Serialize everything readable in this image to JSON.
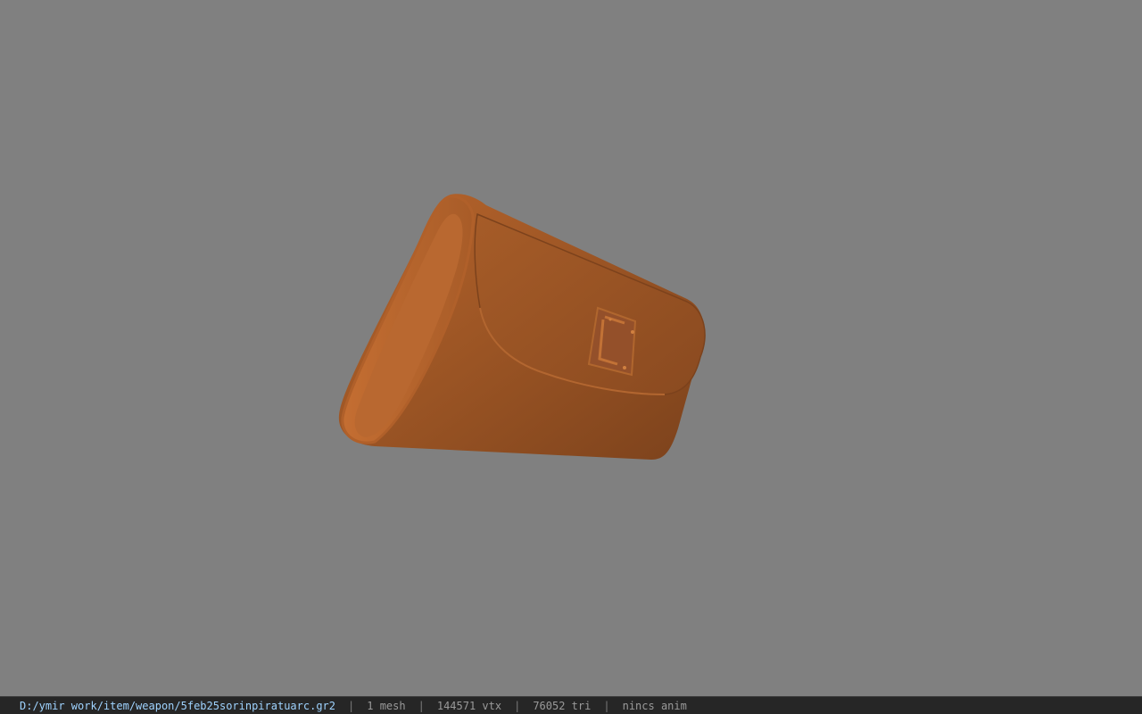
{
  "viewport": {
    "background_color": "#808080",
    "model_color": "#a55a28"
  },
  "statusbar": {
    "file_path": "D:/ymir work/item/weapon/5feb25sorinpiratuarc.gr2",
    "separator": "|",
    "mesh_count": "1 mesh",
    "vertex_count": "144571 vtx",
    "triangle_count": "76052 tri",
    "anim_status": "nincs anim"
  }
}
